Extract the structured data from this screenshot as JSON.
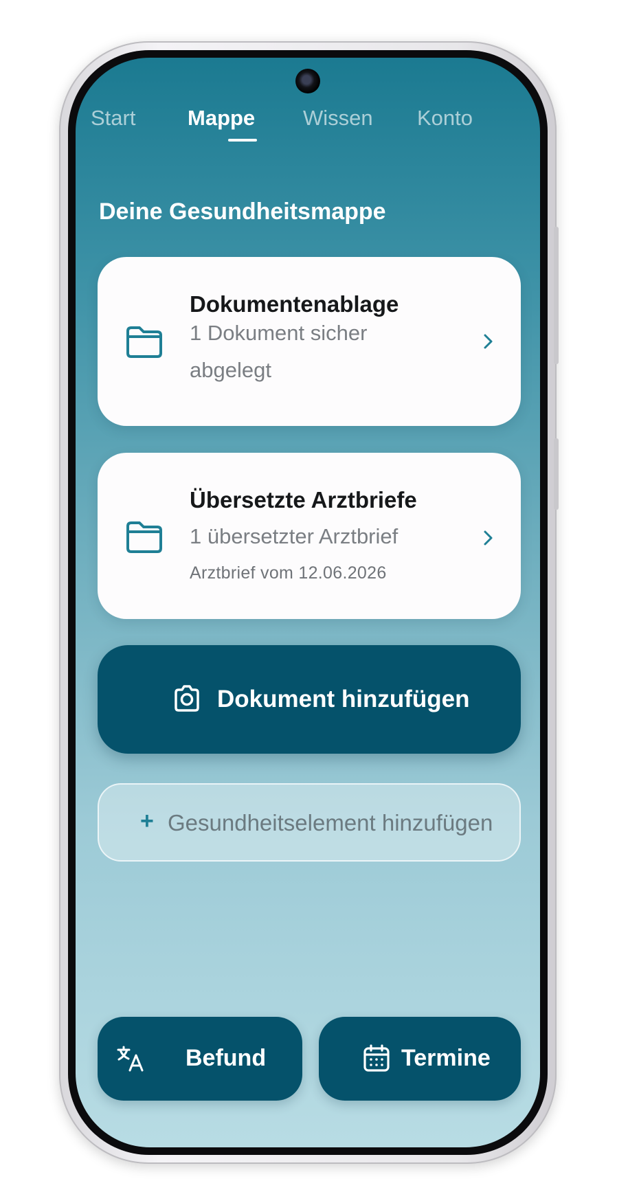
{
  "tabs": [
    {
      "label": "Start",
      "active": false
    },
    {
      "label": "Mappe",
      "active": true
    },
    {
      "label": "Wissen",
      "active": false
    },
    {
      "label": "Konto",
      "active": false
    }
  ],
  "section": {
    "title": "Deine Gesundheitsmappe"
  },
  "cards": [
    {
      "title": "Dokumentenablage",
      "subtitle": "1 Dokument sicher abgelegt",
      "icon": "folder-icon"
    },
    {
      "title": "Übersetzte Arztbriefe",
      "subtitle": "1 übersetzter Arztbrief",
      "meta": "Arztbrief vom 12.06.2026",
      "icon": "folder-icon"
    }
  ],
  "actions": {
    "add_document": {
      "label": "Dokument hinzufügen",
      "icon": "camera-icon"
    },
    "add_health_element": {
      "label": "Gesundheitselement hinzufügen",
      "icon": "plus-icon",
      "plus": "+"
    }
  },
  "bottom_buttons": [
    {
      "label": "Befund",
      "icon": "translate-icon"
    },
    {
      "label": "Termine",
      "icon": "calendar-icon"
    }
  ],
  "colors": {
    "primary": "#05526b",
    "accent": "#1f7f95",
    "card_background": "#fdfcfd"
  }
}
